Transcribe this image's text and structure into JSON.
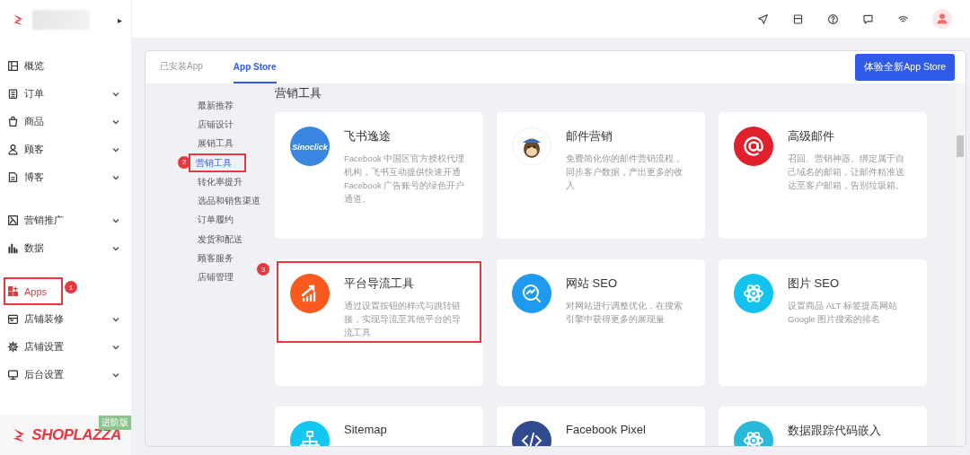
{
  "brand": {
    "caret": "▸",
    "footer_logo": "SHOPLAZZA",
    "edition_badge": "进阶版"
  },
  "sidebar": {
    "groups": [
      [
        {
          "label": "概览",
          "expandable": false,
          "selected": false
        },
        {
          "label": "订单",
          "expandable": true,
          "selected": false
        },
        {
          "label": "商品",
          "expandable": true,
          "selected": false
        },
        {
          "label": "顾客",
          "expandable": true,
          "selected": false
        },
        {
          "label": "博客",
          "expandable": true,
          "selected": false
        }
      ],
      [
        {
          "label": "营销推广",
          "expandable": true,
          "selected": false
        },
        {
          "label": "数据",
          "expandable": true,
          "selected": false
        }
      ],
      [
        {
          "label": "Apps",
          "expandable": false,
          "selected": true,
          "marker": "1"
        },
        {
          "label": "店铺装修",
          "expandable": true,
          "selected": false
        },
        {
          "label": "店铺设置",
          "expandable": true,
          "selected": false
        },
        {
          "label": "后台设置",
          "expandable": true,
          "selected": false
        }
      ]
    ]
  },
  "tabs": [
    {
      "label": "已安装App",
      "selected": false
    },
    {
      "label": "App Store",
      "selected": true
    }
  ],
  "new_store_button": "体验全新App Store",
  "categories": [
    {
      "label": "最新推荐",
      "selected": false
    },
    {
      "label": "店铺设计",
      "selected": false
    },
    {
      "label": "展销工具",
      "selected": false
    },
    {
      "label": "营销工具",
      "selected": true,
      "marker": "2"
    },
    {
      "label": "转化率提升",
      "selected": false
    },
    {
      "label": "选品和销售渠道",
      "selected": false
    },
    {
      "label": "订单履约",
      "selected": false
    },
    {
      "label": "发货和配送",
      "selected": false
    },
    {
      "label": "顾客服务",
      "selected": false
    },
    {
      "label": "店铺管理",
      "selected": false
    }
  ],
  "section_title": "营销工具",
  "apps": [
    {
      "kind": "wordmark",
      "logo_text": "Sinoclick",
      "color": "#3a86e0",
      "title": "飞书逸途",
      "description": "Facebook 中国区官方授权代理机构，飞书互动提供快速开通 Facebook 广告账号的绿色开户通道。"
    },
    {
      "kind": "monkey",
      "color": "#ffffff",
      "title": "邮件营销",
      "description": "免费简化你的邮件营销流程，同步客户数据，产出更多的收入"
    },
    {
      "kind": "at",
      "color": "#e0202a",
      "title": "高级邮件",
      "description": "召回、营销神器。绑定属于自己域名的邮箱，让邮件精准送达至客户邮箱，告别垃圾箱。"
    },
    {
      "kind": "growth",
      "color": "#fa5a1e",
      "title": "平台导流工具",
      "description": "通过设置按钮的样式与跳转链接，实现导流至其他平台的导流工具",
      "marker": "3"
    },
    {
      "kind": "magnifier",
      "color": "#1e9bf0",
      "title": "网站 SEO",
      "description": "对网站进行调整优化，在搜索引擎中获得更多的展现量"
    },
    {
      "kind": "atom",
      "color": "#12c3f0",
      "title": "图片 SEO",
      "description": "设置商品 ALT 标签提高网站 Google 图片搜索的排名"
    },
    {
      "kind": "tree",
      "color": "#12c8f0",
      "title": "Sitemap"
    },
    {
      "kind": "code",
      "color": "#2f4a8f",
      "title": "Facebook Pixel"
    },
    {
      "kind": "atom",
      "color": "#2ab8d8",
      "title": "数据跟踪代码嵌入"
    }
  ]
}
